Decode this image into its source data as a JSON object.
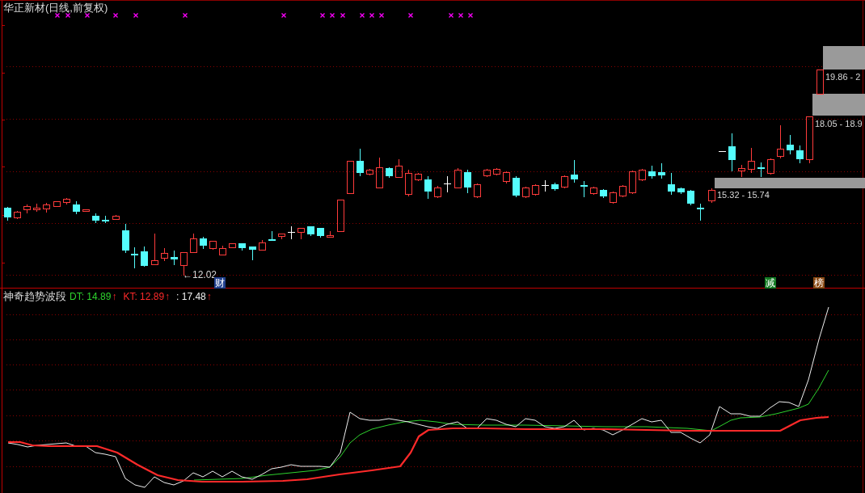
{
  "price_chart": {
    "title": "华正新材(日线,前复权)",
    "low_label": "←12.02",
    "price_zones": [
      {
        "label": "19.86 - 2"
      },
      {
        "label": "18.05 - 18.9"
      },
      {
        "label": "15.32 - 15.74"
      }
    ],
    "event_tags": [
      {
        "text": "财",
        "color": "#21408e"
      },
      {
        "text": "减",
        "color": "#137a22"
      },
      {
        "text": "榜",
        "color": "#8a4a14"
      }
    ]
  },
  "indicator": {
    "title": "神奇趋势波段",
    "series": [
      {
        "label": "DT: 14.89",
        "color": "#2ed42e",
        "trend": "↑"
      },
      {
        "label": "KT: 12.89",
        "color": "#ff2a2a",
        "trend": "↑"
      },
      {
        "label": ": 17.48",
        "color": "#f0f0f0",
        "trend": "↑"
      }
    ]
  }
}
